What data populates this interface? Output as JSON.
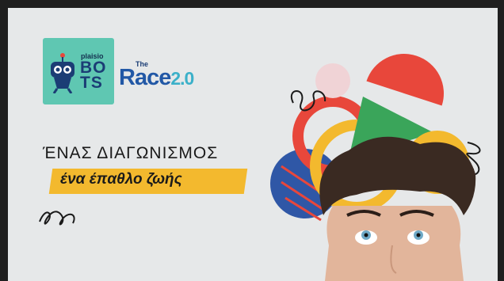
{
  "logo": {
    "brand_small": "plaisio",
    "brand_big": "BO\nTS",
    "the": "The",
    "race": "Race",
    "race_version": "2.0"
  },
  "headline": "ΈΝΑΣ ΔΙΑΓΩΝΙΣΜΟΣ",
  "tagline": "ένα έπαθλο ζωής",
  "colors": {
    "background": "#e6e8e9",
    "logo_teal": "#5fc7b2",
    "navy": "#1b3d75",
    "accent_yellow": "#f3b92e",
    "accent_red": "#e8473b",
    "accent_green": "#3aa55a",
    "accent_blue": "#2f57a6"
  }
}
